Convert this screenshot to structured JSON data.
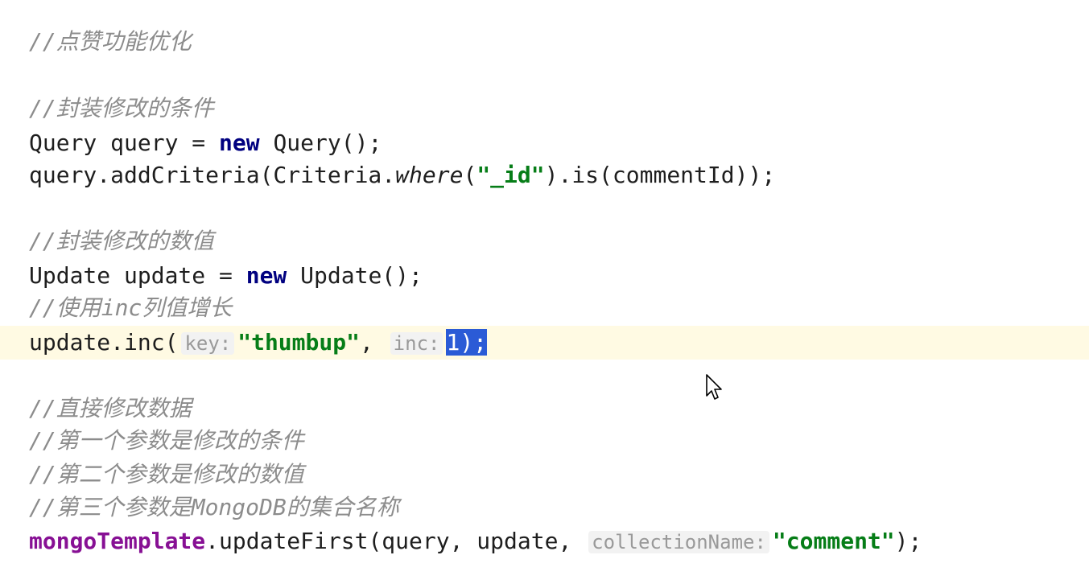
{
  "editor": {
    "lines": {
      "c1": "//点赞功能优化",
      "c2": "//封装修改的条件",
      "l3_type": "Query",
      "l3_var": " query = ",
      "l3_kw": "new",
      "l3_tail": " Query();",
      "l4_head": "query.addCriteria(Criteria.",
      "l4_static": "where",
      "l4_open": "(",
      "l4_str": "\"_id\"",
      "l4_tail": ").is(commentId));",
      "c5": "//封装修改的数值",
      "l6_head": "Update update = ",
      "l6_kw": "new",
      "l6_tail": " Update();",
      "c7": "//使用inc列值增长",
      "l8_head": "update.inc(",
      "l8_hint1": "key:",
      "l8_str": "\"thumbup\"",
      "l8_comma": ",",
      "l8_hint2": "inc:",
      "l8_sel": "1);",
      "c9": "//直接修改数据",
      "c10": "//第一个参数是修改的条件",
      "c11": "//第二个参数是修改的数值",
      "c12": "//第三个参数是MongoDB的集合名称",
      "l13_field": "mongoTemplate",
      "l13_mid": ".updateFirst(query, update,",
      "l13_hint": "collectionName:",
      "l13_str": "\"comment\"",
      "l13_tail": ");"
    }
  },
  "colors": {
    "comment": "#8c8c8c",
    "keyword": "#000080",
    "string": "#067d17",
    "field": "#871094",
    "selection": "#2b5bd6",
    "current_line": "#fffae3"
  },
  "icons": {
    "cursor": "mouse-pointer-icon"
  }
}
